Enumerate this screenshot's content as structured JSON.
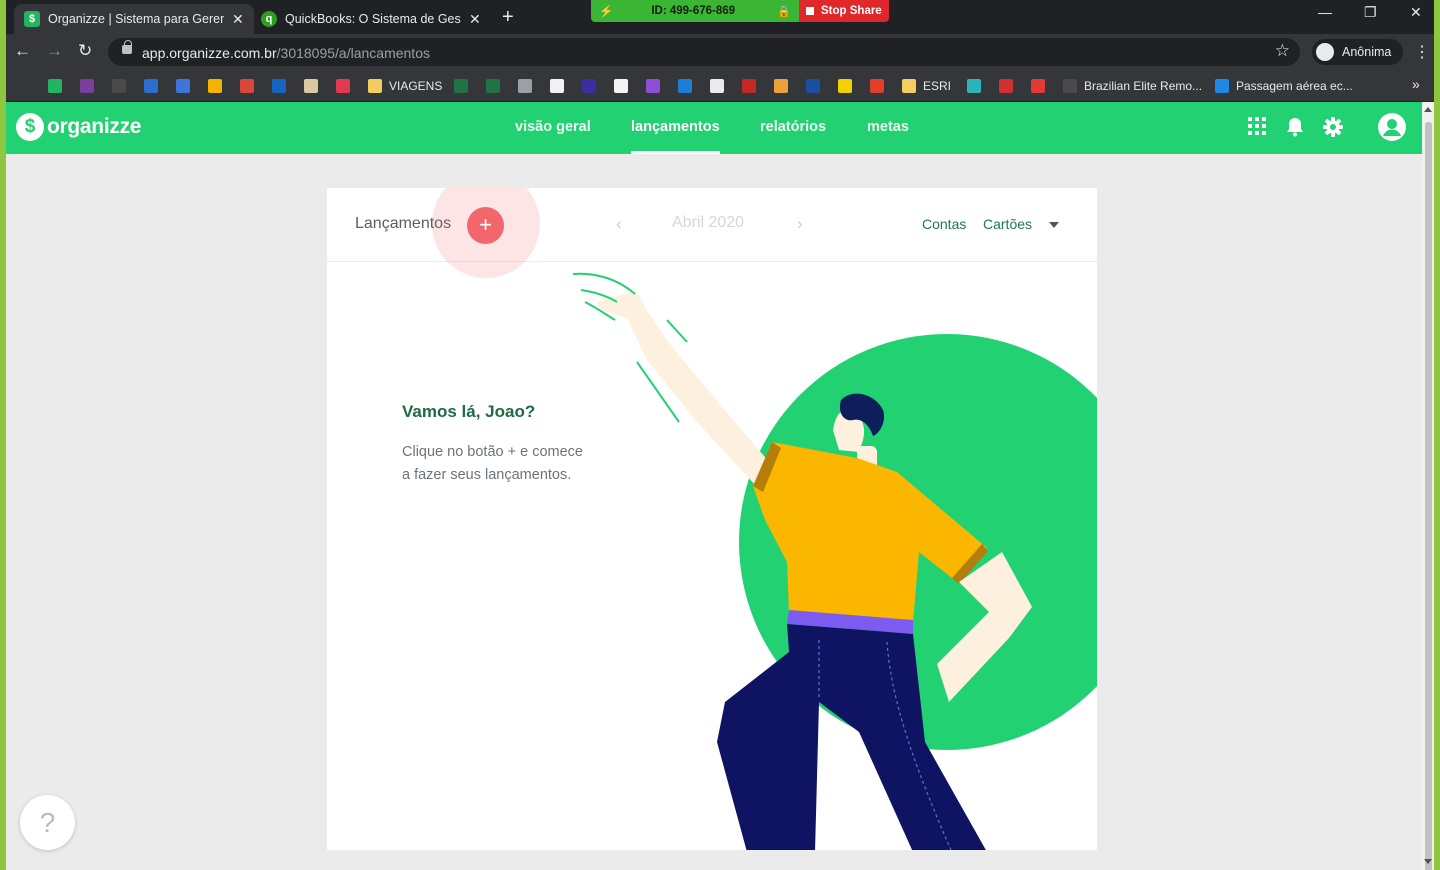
{
  "browser": {
    "tabs": [
      {
        "title": "Organizze | Sistema para Gerenci",
        "favicon": "organizze-favicon",
        "active": true
      },
      {
        "title": "QuickBooks: O Sistema de Gestã",
        "favicon": "quickbooks-favicon",
        "active": false
      }
    ],
    "new_tab": "+",
    "share_bar": {
      "session_id": "ID: 499-676-869",
      "stop_label": "Stop Share"
    },
    "url_host": "app.organizze.com.br",
    "url_path": "/3018095/a/lancamentos",
    "profile_label": "Anônima",
    "bookmarks": [
      {
        "label": "",
        "icon": "im-icon",
        "color": "#35363a"
      },
      {
        "label": "",
        "icon": "organizze-icon",
        "color": "#22b55f"
      },
      {
        "label": "",
        "icon": "tag-icon",
        "color": "#7a3e9d"
      },
      {
        "label": "",
        "icon": "arrow-icon",
        "color": "#4a4a4a"
      },
      {
        "label": "",
        "icon": "firefox-icon",
        "color": "#2c6ecb"
      },
      {
        "label": "",
        "icon": "calendar-icon",
        "color": "#3f74db"
      },
      {
        "label": "",
        "icon": "drive-icon",
        "color": "#f4b400"
      },
      {
        "label": "",
        "icon": "gmail-icon",
        "color": "#d9473b"
      },
      {
        "label": "",
        "icon": "outlook-icon",
        "color": "#1565c0"
      },
      {
        "label": "",
        "icon": "goodreads-icon",
        "color": "#d9c8a1"
      },
      {
        "label": "",
        "icon": "m-icon",
        "color": "#e23a51"
      },
      {
        "label": "VIAGENS",
        "icon": "folder-icon",
        "color": "#f3cd5f"
      },
      {
        "label": "",
        "icon": "excel-icon",
        "color": "#1f7244"
      },
      {
        "label": "",
        "icon": "excel-icon",
        "color": "#1f7244"
      },
      {
        "label": "",
        "icon": "apple-icon",
        "color": "#9aa0a6"
      },
      {
        "label": "",
        "icon": "music-icon",
        "color": "#f2f2f2"
      },
      {
        "label": "",
        "icon": "chart-icon",
        "color": "#3b2ea3"
      },
      {
        "label": "",
        "icon": "amazon-icon",
        "color": "#f4f4f4"
      },
      {
        "label": "",
        "icon": "trello-icon",
        "color": "#8c4fd6"
      },
      {
        "label": "",
        "icon": "vscode-icon",
        "color": "#1c7ed6"
      },
      {
        "label": "",
        "icon": "github-icon",
        "color": "#e8eaed"
      },
      {
        "label": "",
        "icon": "shl-icon",
        "color": "#c62828"
      },
      {
        "label": "",
        "icon": "pinwheel-icon",
        "color": "#e9a23b"
      },
      {
        "label": "",
        "icon": "bars-icon",
        "color": "#1a4fa0"
      },
      {
        "label": "",
        "icon": "smiley-icon",
        "color": "#f5d000"
      },
      {
        "label": "",
        "icon": "arrow-red-icon",
        "color": "#e0402b"
      },
      {
        "label": "ESRI",
        "icon": "folder-icon",
        "color": "#f3cd5f"
      },
      {
        "label": "",
        "icon": "owl-icon",
        "color": "#2bb5b8"
      },
      {
        "label": "",
        "icon": "dots-icon",
        "color": "#d32f2f"
      },
      {
        "label": "",
        "icon": "dx-icon",
        "color": "#e53935"
      },
      {
        "label": "Brazilian Elite Remo...",
        "icon": "globe-icon",
        "color": "#4a4a4a"
      },
      {
        "label": "Passagem aérea ec...",
        "icon": "plane-icon",
        "color": "#1e88e5"
      }
    ],
    "bookmarks_more": "»"
  },
  "app": {
    "logo": "organizze",
    "logo_mark": "$",
    "nav": [
      {
        "label": "visão geral",
        "active": false
      },
      {
        "label": "lançamentos",
        "active": true
      },
      {
        "label": "relatórios",
        "active": false
      },
      {
        "label": "metas",
        "active": false
      }
    ],
    "top_icons": [
      "apps-grid-icon",
      "bell-icon",
      "gear-icon",
      "user-avatar-icon"
    ],
    "card": {
      "title": "Lançamentos",
      "add_symbol": "+",
      "month": "Abril 2020",
      "prev_symbol": "‹",
      "next_symbol": "›",
      "accounts_label": "Contas",
      "cards_label": "Cartões"
    },
    "empty_state": {
      "title": "Vamos lá, Joao?",
      "line1": "Clique no botão + e comece",
      "line2": "a fazer seus lançamentos."
    },
    "help_symbol": "?"
  },
  "colors": {
    "brand_green": "#22d172",
    "add_button": "#f2676c",
    "page_bg": "#ebebeb",
    "chrome_dark": "#202124"
  }
}
